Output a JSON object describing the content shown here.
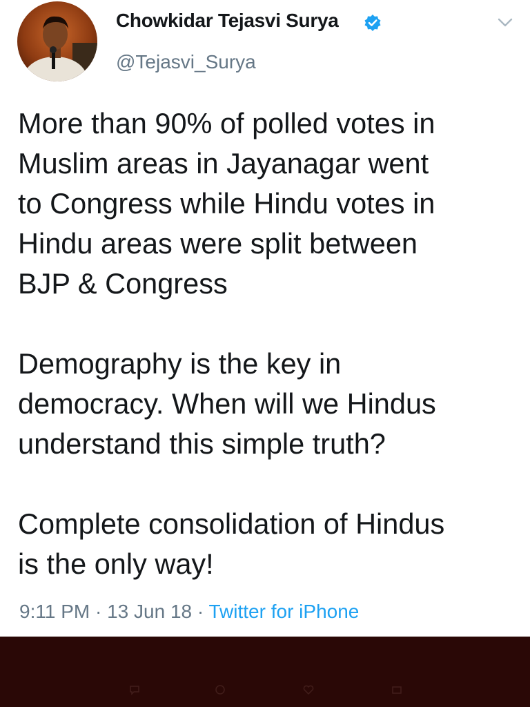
{
  "author": {
    "display_name": "Chowkidar Tejasvi Surya",
    "handle": "@Tejasvi_Surya",
    "verified": true,
    "avatar_icon": "profile-photo"
  },
  "tweet": {
    "paragraphs": [
      "More than 90% of polled votes in\nMuslim areas in Jayanagar went\nto Congress while Hindu votes in\nHindu areas were split between\nBJP & Congress",
      "Demography is the key in\ndemocracy. When will we Hindus\nunderstand this simple truth?",
      "Complete consolidation of Hindus\nis the only way!"
    ],
    "time": "9:11 PM",
    "separator": "·",
    "date": "13 Jun 18",
    "source": "Twitter for iPhone"
  },
  "colors": {
    "text": "#14171a",
    "secondary": "#657786",
    "link": "#1da1f2",
    "verified": "#1da1f2",
    "bottom_bar": "#2a0806"
  },
  "icons": [
    "verified-badge-icon",
    "chevron-down-icon",
    "reply-icon",
    "retweet-icon",
    "like-icon",
    "share-icon"
  ]
}
